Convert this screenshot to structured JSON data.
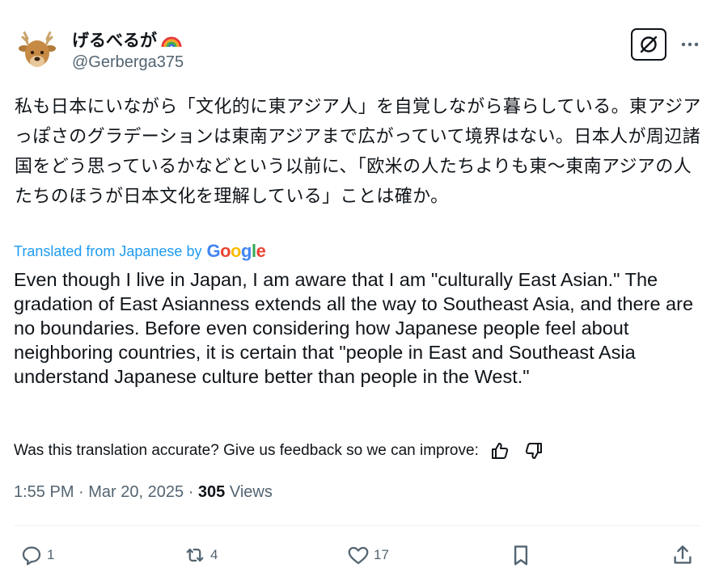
{
  "author": {
    "display_name": "げるべるが",
    "handle": "@Gerberga375",
    "avatar_icon": "deer-avatar-icon",
    "name_emoji": "rainbow-icon"
  },
  "post": {
    "original_text": "私も日本にいながら「文化的に東アジア人」を自覚しながら暮らしている。東アジアっぽさのグラデーションは東南アジアまで広がっていて境界はない。日本人が周辺諸国をどう思っているかなどという以前に、「欧米の人たちよりも東〜東南アジアの人たちのほうが日本文化を理解している」ことは確か。",
    "translated_from": "Translated from Japanese by",
    "translator_brand": "Google",
    "translation": "Even though I live in Japan, I am aware that I am \"culturally East Asian.\" The gradation of East Asianness extends all the way to Southeast Asia, and there are no boundaries. Before even considering how Japanese people feel about neighboring countries, it is certain that \"people in East and Southeast Asia understand Japanese culture better than people in the West.\"",
    "feedback_prompt": "Was this translation accurate? Give us feedback so we can improve:",
    "time": "1:55 PM",
    "date": "Mar 20, 2025",
    "views_count": "305",
    "views_label": "Views"
  },
  "actions": {
    "replies": "1",
    "reposts": "4",
    "likes": "17"
  },
  "colors": {
    "link_blue": "#1d9bf0",
    "secondary_text": "#536471",
    "primary_text": "#0f1419"
  }
}
